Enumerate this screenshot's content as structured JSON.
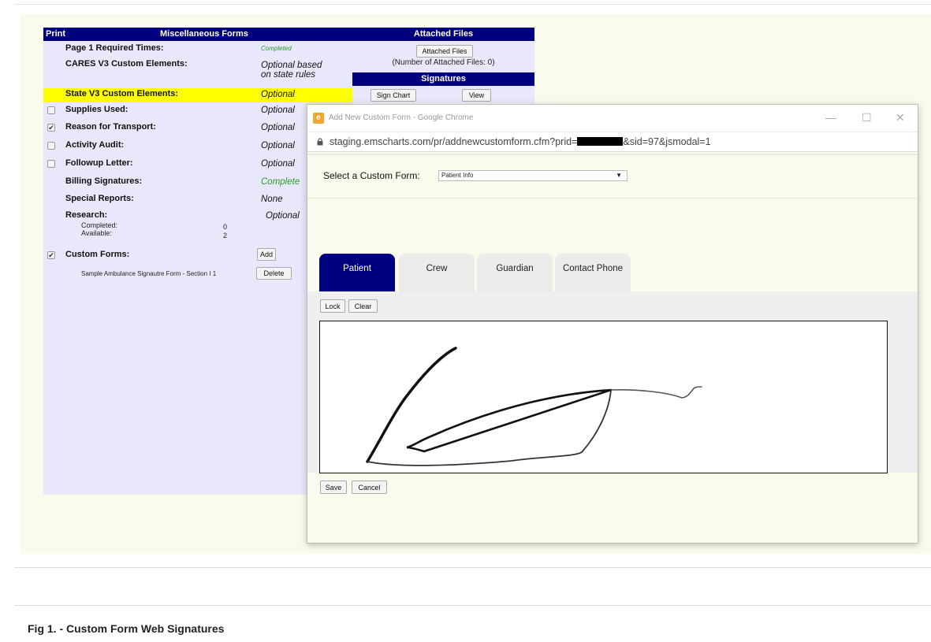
{
  "misc": {
    "print_header": "Print",
    "title": "Miscellaneous Forms",
    "rows": [
      {
        "label": "Page 1 Required Times:",
        "value": "Completed"
      },
      {
        "label": "CARES V3 Custom Elements:",
        "value_line1": "Optional based",
        "value_line2": "on state rules"
      },
      {
        "label": "State V3 Custom Elements:",
        "value": "Optional"
      },
      {
        "label": "Supplies Used:",
        "value": "Optional"
      },
      {
        "label": "Reason for Transport:",
        "value": "Optional"
      },
      {
        "label": "Activity Audit:",
        "value": "Optional"
      },
      {
        "label": "Followup Letter:",
        "value": "Optional"
      },
      {
        "label": "Billing Signatures:",
        "value": "Complete"
      },
      {
        "label": "Special Reports:",
        "value": "None"
      },
      {
        "label": "Research:",
        "value": "Optional"
      },
      {
        "label": "Custom Forms:"
      }
    ],
    "research": {
      "completed_label": "Completed:",
      "completed_value": "0",
      "available_label": "Available:",
      "available_value": "2"
    },
    "add_button": "Add",
    "sample_form": "Sample Ambulance Signautre Form - Section I 1",
    "delete_button": "Delete"
  },
  "files": {
    "title": "Attached Files",
    "button": "Attached Files",
    "count": "(Number of Attached Files: 0)",
    "signatures_title": "Signatures",
    "sign_chart_button": "Sign Chart",
    "view_button": "View"
  },
  "modal": {
    "window_title": "Add New Custom Form - Google Chrome",
    "url_prefix": "staging.emscharts.com/pr/addnewcustomform.cfm?prid=",
    "url_suffix": "&sid=97&jsmodal=1",
    "select_label": "Select a Custom Form:",
    "select_value": "Patient Info",
    "tabs": [
      "Patient",
      "Crew",
      "Guardian",
      "Contact Phone"
    ],
    "lock_button": "Lock",
    "clear_button": "Clear",
    "save_button": "Save",
    "cancel_button": "Cancel"
  },
  "caption": "Fig 1. - Custom Form Web Signatures"
}
